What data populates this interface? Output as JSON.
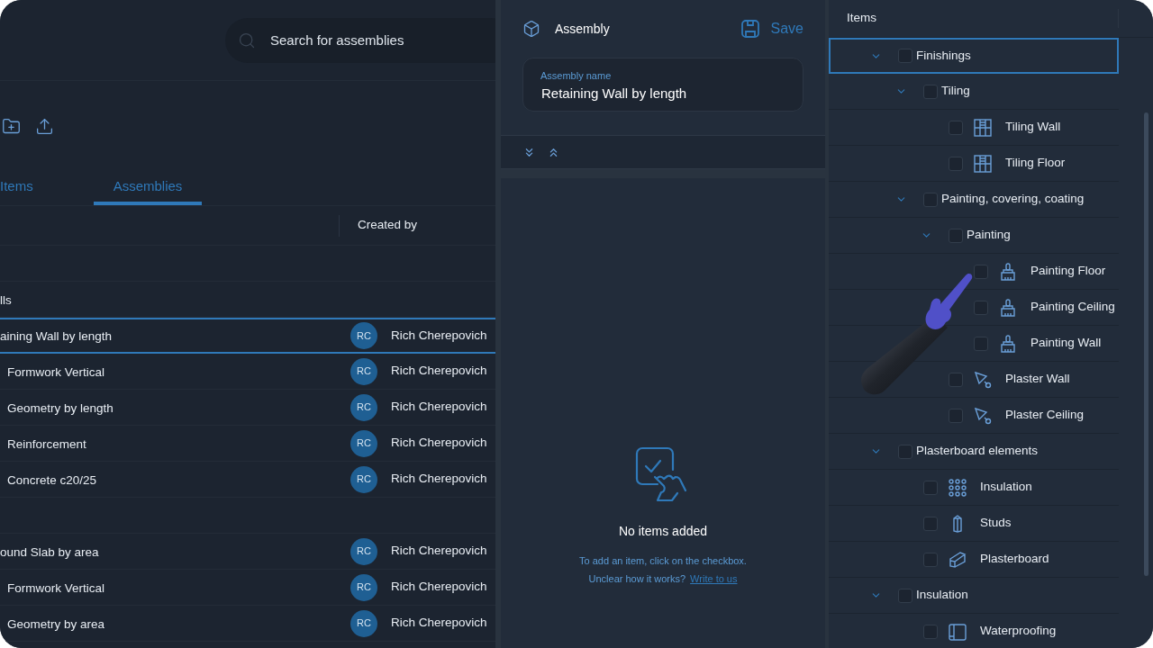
{
  "library": {
    "search": {
      "placeholder": "Search for assemblies"
    },
    "tabs": [
      {
        "label": "Items",
        "selected": false
      },
      {
        "label": "Assemblies",
        "selected": true
      }
    ],
    "table": {
      "columns": [
        "Created by"
      ],
      "rows": [
        {
          "kind": "empty",
          "selected": false
        },
        {
          "kind": "group",
          "name": "lls",
          "selected": false
        },
        {
          "kind": "assembly",
          "name": "aining Wall by length",
          "initials": "RC",
          "creator": "Rich Cherepovich",
          "selected": true
        },
        {
          "kind": "component",
          "name": "Formwork Vertical",
          "initials": "RC",
          "creator": "Rich Cherepovich",
          "selected": false
        },
        {
          "kind": "component",
          "name": "Geometry by length",
          "initials": "RC",
          "creator": "Rich Cherepovich",
          "selected": false
        },
        {
          "kind": "component",
          "name": "Reinforcement",
          "initials": "RC",
          "creator": "Rich Cherepovich",
          "selected": false
        },
        {
          "kind": "component",
          "name": "Concrete c20/25",
          "initials": "RC",
          "creator": "Rich Cherepovich",
          "selected": false
        },
        {
          "kind": "empty",
          "selected": false
        },
        {
          "kind": "assembly",
          "name": "ound Slab by area",
          "initials": "RC",
          "creator": "Rich Cherepovich",
          "selected": false
        },
        {
          "kind": "component",
          "name": "Formwork Vertical",
          "initials": "RC",
          "creator": "Rich Cherepovich",
          "selected": false
        },
        {
          "kind": "component",
          "name": "Geometry by area",
          "initials": "RC",
          "creator": "Rich Cherepovich",
          "selected": false
        }
      ]
    }
  },
  "assembly": {
    "title": "Assembly",
    "save": "Save",
    "name_field": {
      "label": "Assembly name",
      "value": "Retaining Wall by length"
    },
    "empty_state": {
      "title": "No items added",
      "hint": "To add an item, click on the checkbox.",
      "question": "Unclear how it works?",
      "link": "Write to us"
    }
  },
  "items": {
    "title": "Items",
    "tree": [
      {
        "label": "Finishings",
        "expanded": true,
        "checked": false,
        "selected": true,
        "children": [
          {
            "label": "Tiling",
            "expanded": true,
            "checked": false,
            "selected": false,
            "children": [
              {
                "label": "Tiling Wall",
                "kind": "tile",
                "checked": false,
                "selected": false
              },
              {
                "label": "Tiling Floor",
                "kind": "tile",
                "checked": false,
                "selected": false
              }
            ]
          },
          {
            "label": "Painting, covering, coating",
            "expanded": true,
            "checked": false,
            "selected": false,
            "children": [
              {
                "label": "Painting",
                "expanded": true,
                "checked": false,
                "selected": false,
                "children": [
                  {
                    "label": "Painting Floor",
                    "kind": "brush",
                    "checked": false,
                    "selected": false
                  },
                  {
                    "label": "Painting Ceiling",
                    "kind": "brush",
                    "checked": false,
                    "selected": false
                  },
                  {
                    "label": "Painting Wall",
                    "kind": "brush",
                    "checked": false,
                    "selected": false
                  }
                ]
              },
              {
                "label": "Plaster Wall",
                "kind": "trowel",
                "checked": false,
                "selected": false
              },
              {
                "label": "Plaster Ceiling",
                "kind": "trowel",
                "checked": false,
                "selected": false
              }
            ]
          }
        ]
      },
      {
        "label": "Plasterboard elements",
        "expanded": true,
        "checked": false,
        "selected": false,
        "children": [
          {
            "label": "Insulation",
            "kind": "dots",
            "checked": false,
            "selected": false
          },
          {
            "label": "Studs",
            "kind": "stud",
            "checked": false,
            "selected": false
          },
          {
            "label": "Plasterboard",
            "kind": "board",
            "checked": false,
            "selected": false
          }
        ]
      },
      {
        "label": "Insulation",
        "expanded": true,
        "checked": false,
        "selected": false,
        "children": [
          {
            "label": "Waterproofing",
            "kind": "roll",
            "checked": false,
            "selected": false
          }
        ]
      }
    ]
  }
}
